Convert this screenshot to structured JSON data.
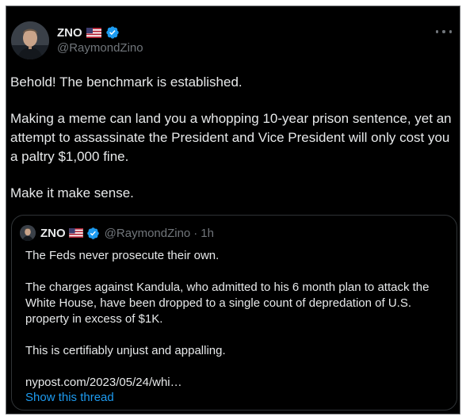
{
  "author": {
    "display_name": "ZNO",
    "handle": "@RaymondZino",
    "flag_icon": "us-flag-icon",
    "verified_icon": "verified-badge-icon",
    "verified_color": "#1d9bf0"
  },
  "more_icon": "more-horizontal-icon",
  "tweet": {
    "paragraphs": [
      "Behold! The benchmark is established.",
      "Making a meme can land you a whopping 10-year prison sentence, yet an attempt to assassinate the President and Vice President will only cost you a paltry $1,000 fine.",
      "Make it make sense."
    ]
  },
  "quoted": {
    "display_name": "ZNO",
    "handle": "@RaymondZino",
    "separator": "·",
    "time": "1h",
    "paragraphs": [
      "The Feds never prosecute their own.",
      "The charges against Kandula, who admitted to his 6 month plan to attack the White House, have been dropped to a single count of depredation of U.S. property in excess of $1K.",
      "This is certifiably unjust and appalling.",
      "nypost.com/2023/05/24/whi…"
    ],
    "show_thread": "Show this thread"
  },
  "colors": {
    "background": "#000000",
    "text": "#e7e9ea",
    "muted": "#71767b",
    "accent": "#1d9bf0",
    "border": "#2f3336"
  }
}
